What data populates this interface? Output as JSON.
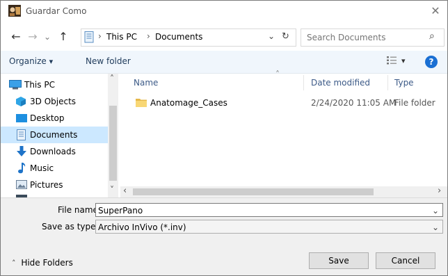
{
  "window": {
    "title": "Guardar Como",
    "close_glyph": "✕"
  },
  "nav": {
    "back_glyph": "←",
    "forward_glyph": "→",
    "recent_glyph": "⌄",
    "up_glyph": "↑",
    "path_separator": "›",
    "path": [
      "This PC",
      "Documents"
    ],
    "address_dropdown_glyph": "⌄",
    "refresh_glyph": "↻",
    "search_placeholder": "Search Documents",
    "search_glyph": "⌕"
  },
  "toolbar": {
    "organize_label": "Organize",
    "organize_arrow": "▾",
    "new_folder_label": "New folder",
    "view_arrow": "▾",
    "help_glyph": "?"
  },
  "tree": {
    "items": [
      {
        "label": "This PC",
        "icon": "pc-icon"
      },
      {
        "label": "3D Objects",
        "icon": "cube-icon"
      },
      {
        "label": "Desktop",
        "icon": "desktop-icon"
      },
      {
        "label": "Documents",
        "icon": "documents-icon",
        "selected": true
      },
      {
        "label": "Downloads",
        "icon": "download-icon"
      },
      {
        "label": "Music",
        "icon": "music-icon"
      },
      {
        "label": "Pictures",
        "icon": "pictures-icon"
      }
    ],
    "scroll_up_glyph": "˄",
    "scroll_down_glyph": "˅"
  },
  "files": {
    "columns": [
      "Name",
      "Date modified",
      "Type"
    ],
    "sort_glyph": "˄",
    "rows": [
      {
        "name": "Anatomage_Cases",
        "date": "2/24/2020 11:05 AM",
        "type": "File folder"
      }
    ],
    "scroll_left_glyph": "‹",
    "scroll_right_glyph": "›"
  },
  "footer": {
    "file_name_label": "File name:",
    "file_name_value": "SuperPano",
    "save_type_label": "Save as type:",
    "save_type_value": "Archivo InVivo (*.inv)",
    "dropdown_glyph": "⌄",
    "hide_folders_glyph": "˄",
    "hide_folders_label": "Hide Folders",
    "save_label": "Save",
    "cancel_label": "Cancel"
  },
  "colors": {
    "toolbar_bg": "#f0f6fc",
    "selected_bg": "#cce8ff",
    "folder_yellow": "#f8d775",
    "help_blue": "#1a6fd3",
    "header_text": "#3c5a87"
  }
}
